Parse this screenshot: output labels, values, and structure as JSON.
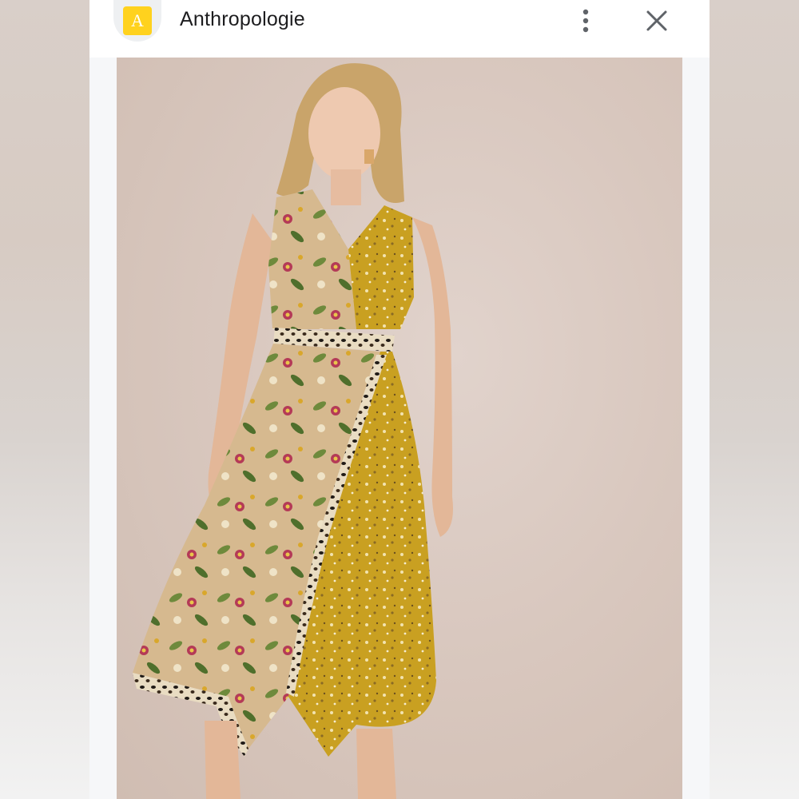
{
  "header": {
    "favicon_letter": "A",
    "site_name": "Anthropologie"
  },
  "icons": {
    "menu": "more-vertical-icon",
    "close": "close-icon"
  },
  "colors": {
    "favicon_bg": "#ffd21e",
    "photo_bg": "#d9c8bf",
    "dress_left": "#d2b48c",
    "dress_right": "#c9a021"
  }
}
